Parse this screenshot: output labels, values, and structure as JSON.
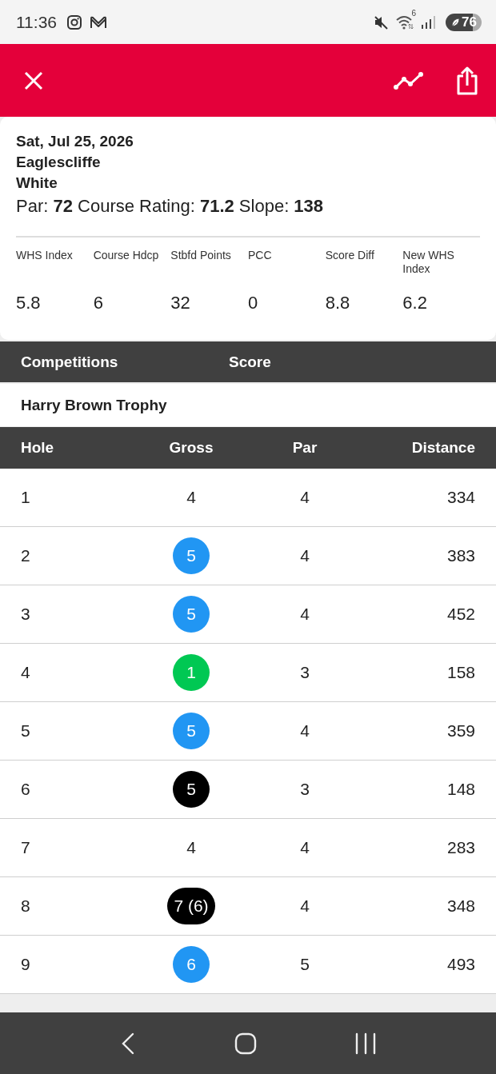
{
  "status_bar": {
    "time": "11:36",
    "wifi_badge": "6",
    "battery": "76"
  },
  "summary": {
    "date": "Sat, Jul 25, 2026",
    "course": "Eaglescliffe",
    "tee": "White",
    "ratings": "Par: **72** Course Rating: **71.2** Slope: **138**",
    "stats": [
      {
        "label": "WHS Index",
        "value": "5.8"
      },
      {
        "label": "Course Hdcp",
        "value": "6"
      },
      {
        "label": "Stbfd Points",
        "value": "32"
      },
      {
        "label": "PCC",
        "value": "0"
      },
      {
        "label": "Score Diff",
        "value": "8.8"
      },
      {
        "label": "New WHS Index",
        "value": "6.2"
      }
    ]
  },
  "competitions": {
    "columns": [
      "Competitions",
      "Score"
    ],
    "rows": [
      {
        "name": "Harry Brown Trophy"
      }
    ]
  },
  "scorecard": {
    "columns": [
      "Hole",
      "Gross",
      "Par",
      "Distance"
    ],
    "rows": [
      {
        "hole": "1",
        "gross": "4",
        "par": "4",
        "distance": "334"
      },
      {
        "hole": "2",
        "gross": "5",
        "color": "#2196f3",
        "par": "4",
        "distance": "383"
      },
      {
        "hole": "3",
        "gross": "5",
        "color": "#2196f3",
        "par": "4",
        "distance": "452"
      },
      {
        "hole": "4",
        "gross": "1",
        "color": "#00c853",
        "par": "3",
        "distance": "158"
      },
      {
        "hole": "5",
        "gross": "5",
        "color": "#2196f3",
        "par": "4",
        "distance": "359"
      },
      {
        "hole": "6",
        "gross": "5",
        "color": "#000000",
        "par": "3",
        "distance": "148"
      },
      {
        "hole": "7",
        "gross": "4",
        "par": "4",
        "distance": "283"
      },
      {
        "hole": "8",
        "gross": "7 (6)",
        "color": "#000000",
        "par": "4",
        "distance": "348"
      },
      {
        "hole": "9",
        "gross": "6",
        "color": "#2196f3",
        "par": "5",
        "distance": "493"
      }
    ]
  }
}
